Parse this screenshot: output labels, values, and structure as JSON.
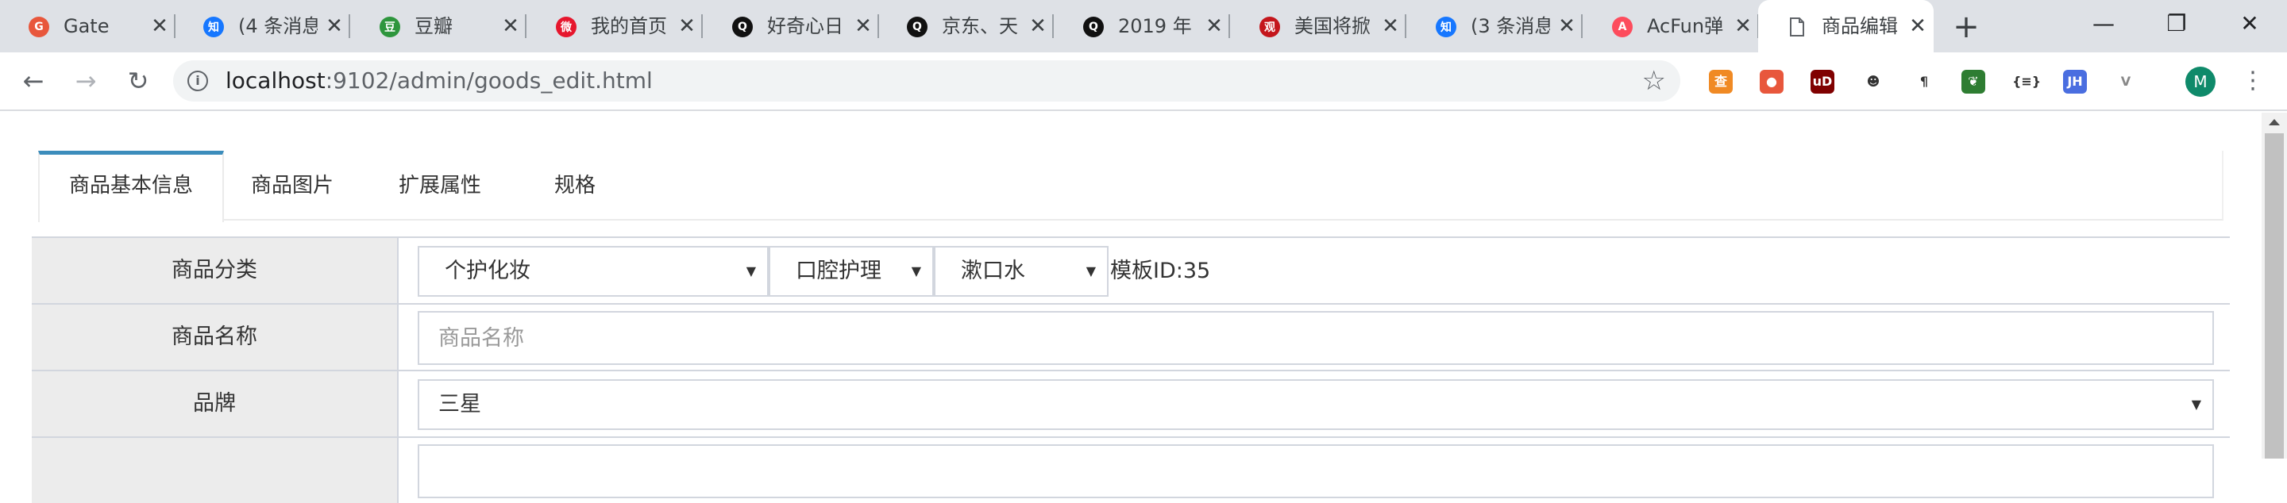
{
  "browser": {
    "tabs": [
      {
        "title": "Gate",
        "favicon": "gate-favicon",
        "color": "#e8573c"
      },
      {
        "title": "(4 条消息",
        "favicon": "zhihu-favicon",
        "color": "#1677ff"
      },
      {
        "title": "豆瓣",
        "favicon": "douban-favicon",
        "color": "#2e963d"
      },
      {
        "title": "我的首页",
        "favicon": "weibo-favicon",
        "color": "#e6162d"
      },
      {
        "title": "好奇心日",
        "favicon": "qdaily-favicon",
        "color": "#111111"
      },
      {
        "title": "京东、天",
        "favicon": "qdaily-favicon",
        "color": "#111111"
      },
      {
        "title": "2019 年",
        "favicon": "qdaily-favicon",
        "color": "#111111"
      },
      {
        "title": "美国将掀",
        "favicon": "guancha-favicon",
        "color": "#c4161c"
      },
      {
        "title": "(3 条消息",
        "favicon": "zhihu-favicon",
        "color": "#1677ff"
      },
      {
        "title": "AcFun弹",
        "favicon": "acfun-favicon",
        "color": "#fd4c5d"
      },
      {
        "title": "商品编辑",
        "favicon": "document-favicon",
        "color": "#ffffff"
      }
    ],
    "favicon_glyphs": [
      "G",
      "知",
      "豆",
      "微",
      "Q",
      "Q",
      "Q",
      "观",
      "知",
      "A",
      ""
    ],
    "close_glyph": "✕",
    "new_tab": "+",
    "window_controls": {
      "minimize": "—",
      "restore": "❐",
      "close": "✕"
    },
    "address": {
      "host": "localhost",
      "rest": ":9102/admin/goods_edit.html"
    },
    "nav": {
      "back": "←",
      "forward": "→",
      "reload": "↻"
    },
    "star": "☆",
    "info": "i",
    "extensions": [
      {
        "name": "ext-orange-icon",
        "glyph": "查",
        "color": "#f08a24"
      },
      {
        "name": "ext-map-pin-icon",
        "glyph": "●",
        "color": "#e8573c"
      },
      {
        "name": "ext-ublock-icon",
        "glyph": "uD",
        "color": "#800000"
      },
      {
        "name": "ext-spy-icon",
        "glyph": "☻",
        "color": "#333333"
      },
      {
        "name": "ext-pilcrow-icon",
        "glyph": "¶",
        "color": "#333333"
      },
      {
        "name": "ext-leaf-icon",
        "glyph": "❦",
        "color": "#2e7d32"
      },
      {
        "name": "ext-json-icon",
        "glyph": "{≡}",
        "color": "#333333"
      },
      {
        "name": "ext-jh-icon",
        "glyph": "JH",
        "color": "#4a6ee0"
      },
      {
        "name": "ext-vue-icon",
        "glyph": "V",
        "color": "#888888"
      }
    ],
    "avatar": "M",
    "menu": "⋮"
  },
  "page": {
    "tabs": [
      "商品基本信息",
      "商品图片",
      "扩展属性",
      "规格"
    ],
    "active_tab": 0,
    "accent_color": "#3c8dbc",
    "form": {
      "category_label": "商品分类",
      "category1": "个护化妆",
      "category2": "口腔护理",
      "category3": "漱口水",
      "template_id": "模板ID:35",
      "name_label": "商品名称",
      "name_placeholder": "商品名称",
      "brand_label": "品牌",
      "brand_value": "三星"
    }
  }
}
